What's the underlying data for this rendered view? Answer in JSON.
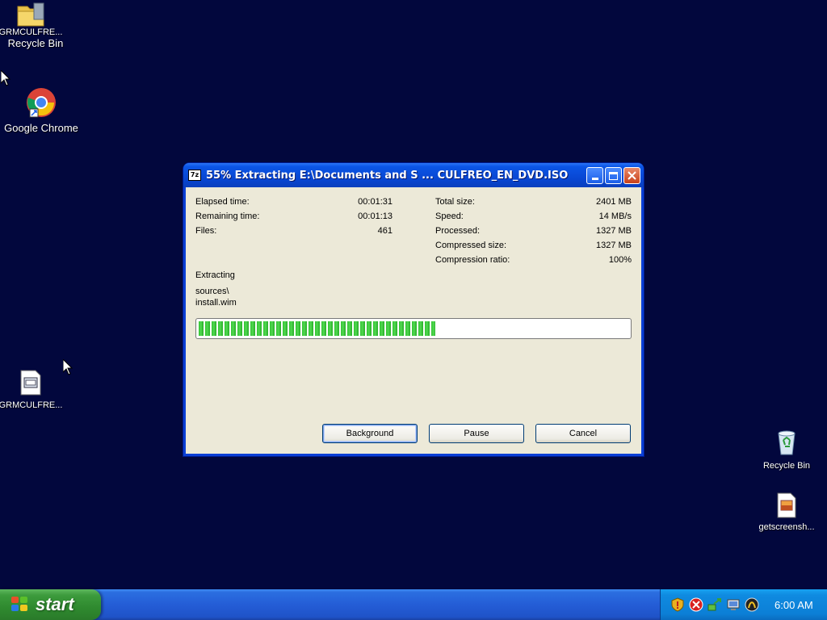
{
  "desktop": {
    "icons": {
      "top_folder_label": "GRMCULFRE...",
      "recycle_top_label": "Recycle Bin",
      "chrome_label": "Google Chrome",
      "iso_file_label": "GRMCULFRE...",
      "recycle_right_label": "Recycle Bin",
      "screenshot_label": "getscreensh..."
    }
  },
  "dialog": {
    "title_icon": "7z",
    "title": "55% Extracting E:\\Documents and S ... CULFREO_EN_DVD.ISO",
    "stats_left": [
      {
        "label": "Elapsed time:",
        "value": "00:01:31"
      },
      {
        "label": "Remaining time:",
        "value": "00:01:13"
      },
      {
        "label": "Files:",
        "value": "461"
      }
    ],
    "stats_right": [
      {
        "label": "Total size:",
        "value": "2401 MB"
      },
      {
        "label": "Speed:",
        "value": "14 MB/s"
      },
      {
        "label": "Processed:",
        "value": "1327 MB"
      },
      {
        "label": "Compressed size:",
        "value": "1327 MB"
      },
      {
        "label": "Compression ratio:",
        "value": "100%"
      }
    ],
    "status_label": "Extracting",
    "current_path": "sources\\",
    "current_file": "install.wim",
    "progress_percent": 55,
    "buttons": {
      "background": "Background",
      "pause": "Pause",
      "cancel": "Cancel"
    }
  },
  "taskbar": {
    "start_label": "start",
    "clock": "6:00 AM"
  },
  "colors": {
    "desktop_bg": "#02073d",
    "progress_green": "#33c433",
    "taskbar_blue": "#245dd6",
    "start_green": "#3c9a3c"
  }
}
